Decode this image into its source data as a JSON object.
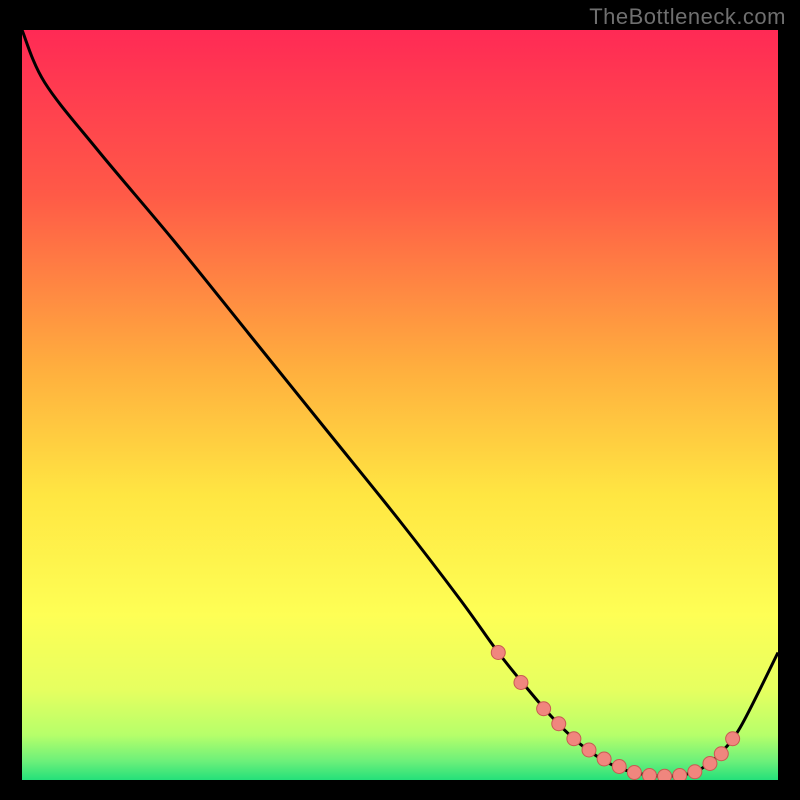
{
  "attribution": "TheBottleneck.com",
  "colors": {
    "frame_bg": "#000000",
    "attribution_text": "#6f6f6f",
    "gradient_top": "#ff2a55",
    "gradient_upper_mid": "#ff8a3a",
    "gradient_mid": "#ffe642",
    "gradient_lower_mid": "#f6ff5a",
    "gradient_near_bottom": "#b6ff6a",
    "gradient_bottom": "#24e07a",
    "curve_stroke": "#000000",
    "marker_fill": "#f0867e",
    "marker_stroke": "#c85a52"
  },
  "gradient_stops": [
    {
      "offset": 0.0,
      "color": "#ff2a55"
    },
    {
      "offset": 0.22,
      "color": "#ff5a47"
    },
    {
      "offset": 0.45,
      "color": "#ffae3e"
    },
    {
      "offset": 0.62,
      "color": "#ffe642"
    },
    {
      "offset": 0.78,
      "color": "#feff55"
    },
    {
      "offset": 0.88,
      "color": "#e6ff60"
    },
    {
      "offset": 0.94,
      "color": "#b6ff6a"
    },
    {
      "offset": 0.975,
      "color": "#6cf07a"
    },
    {
      "offset": 1.0,
      "color": "#24e07a"
    }
  ],
  "chart_data": {
    "type": "line",
    "title": "",
    "xlabel": "",
    "ylabel": "",
    "xlim": [
      0,
      100
    ],
    "ylim": [
      0,
      100
    ],
    "x": [
      0,
      3,
      10,
      20,
      30,
      40,
      50,
      58,
      63,
      67,
      70,
      73,
      76,
      79,
      82,
      85,
      88,
      90,
      92,
      95,
      100
    ],
    "y": [
      100,
      93,
      84,
      72,
      59.5,
      47,
      34.5,
      24,
      17,
      12,
      8.5,
      5.5,
      3.2,
      1.6,
      0.8,
      0.5,
      0.8,
      1.6,
      3.2,
      7,
      17
    ],
    "markers_x": [
      63,
      66,
      69,
      71,
      73,
      75,
      77,
      79,
      81,
      83,
      85,
      87,
      89,
      91,
      92.5,
      94
    ],
    "markers_y": [
      17,
      13,
      9.5,
      7.5,
      5.5,
      4,
      2.8,
      1.8,
      1,
      0.6,
      0.5,
      0.6,
      1.1,
      2.2,
      3.5,
      5.5
    ],
    "legend": []
  }
}
